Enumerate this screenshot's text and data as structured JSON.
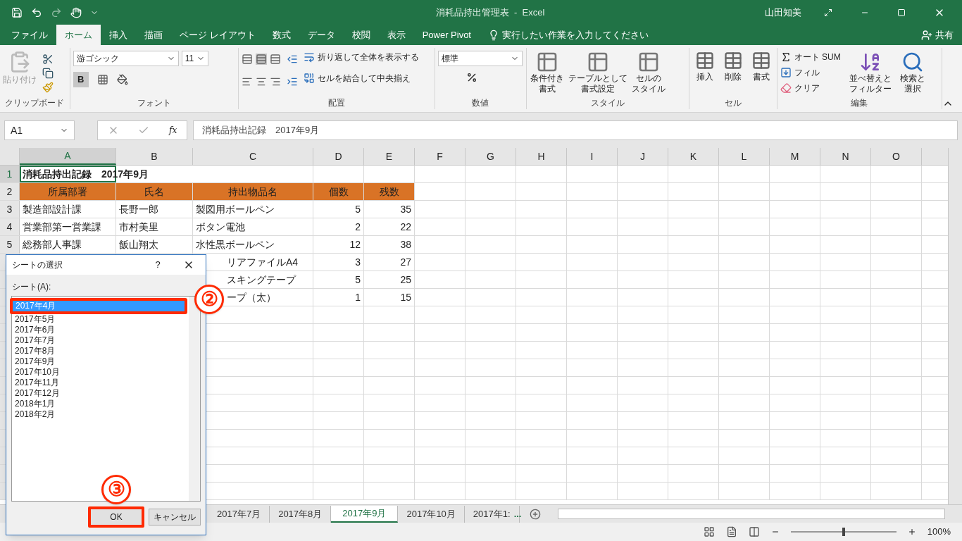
{
  "title_bar": {
    "title": "消耗品持出管理表  -  Excel",
    "user": "山田知美"
  },
  "menu_tabs": [
    {
      "label": "ファイル",
      "selected": false
    },
    {
      "label": "ホーム",
      "selected": true
    },
    {
      "label": "挿入",
      "selected": false
    },
    {
      "label": "描画",
      "selected": false
    },
    {
      "label": "ページ レイアウト",
      "selected": false
    },
    {
      "label": "数式",
      "selected": false
    },
    {
      "label": "データ",
      "selected": false
    },
    {
      "label": "校閲",
      "selected": false
    },
    {
      "label": "表示",
      "selected": false
    },
    {
      "label": "Power Pivot",
      "selected": false
    }
  ],
  "tell_me": "実行したい作業を入力してください",
  "share": "共有",
  "ribbon": {
    "clipboard": {
      "label": "クリップボード",
      "paste": "貼り付け"
    },
    "font": {
      "label": "フォント",
      "font_name": "游ゴシック",
      "font_size": "11",
      "bold_label": "B",
      "bold": true
    },
    "alignment": {
      "label": "配置",
      "wrap": "折り返して全体を表示する",
      "merge": "セルを結合して中央揃え"
    },
    "number": {
      "label": "数値",
      "format": "標準"
    },
    "styles": {
      "label": "スタイル",
      "buttons": [
        [
          "条件付き",
          "書式"
        ],
        [
          "テーブルとして",
          "書式設定"
        ],
        [
          "セルの",
          "スタイル"
        ]
      ]
    },
    "cells": {
      "label": "セル",
      "buttons": [
        "挿入",
        "削除",
        "書式"
      ]
    },
    "editing": {
      "label": "編集",
      "autosum": "オート SUM",
      "fill": "フィル",
      "clear": "クリア",
      "sort": [
        "並べ替えと",
        "フィルター"
      ],
      "find": [
        "検索と",
        "選択"
      ]
    }
  },
  "formula_bar": {
    "name_box": "A1",
    "function_label": "fx",
    "formula": "消耗品持出記録　2017年9月"
  },
  "columns": [
    {
      "label": "A",
      "selected": true
    },
    {
      "label": "B",
      "selected": false
    },
    {
      "label": "C",
      "selected": false
    },
    {
      "label": "D",
      "selected": false
    },
    {
      "label": "E",
      "selected": false
    },
    {
      "label": "F",
      "selected": false
    },
    {
      "label": "G",
      "selected": false
    },
    {
      "label": "H",
      "selected": false
    },
    {
      "label": "I",
      "selected": false
    },
    {
      "label": "J",
      "selected": false
    },
    {
      "label": "K",
      "selected": false
    },
    {
      "label": "L",
      "selected": false
    },
    {
      "label": "M",
      "selected": false
    },
    {
      "label": "N",
      "selected": false
    },
    {
      "label": "O",
      "selected": false
    }
  ],
  "rows": [
    {
      "number": "1",
      "selected": true,
      "kind": "title",
      "cells": [
        "消耗品持出記録　2017年9月"
      ]
    },
    {
      "number": "2",
      "selected": false,
      "kind": "header",
      "cells": [
        "所属部署",
        "氏名",
        "持出物品名",
        "個数",
        "残数"
      ]
    },
    {
      "number": "3",
      "selected": false,
      "kind": "data",
      "cells": [
        "製造部設計課",
        "長野一郎",
        "製図用ボールペン",
        "5",
        "35"
      ]
    },
    {
      "number": "4",
      "selected": false,
      "kind": "data",
      "cells": [
        "営業部第一営業課",
        "市村美里",
        "ボタン電池",
        "2",
        "22"
      ]
    },
    {
      "number": "5",
      "selected": false,
      "kind": "data",
      "cells": [
        "総務部人事課",
        "飯山翔太",
        "水性黒ボールペン",
        "12",
        "38"
      ]
    },
    {
      "kind": "covered",
      "cells": [
        "",
        "",
        "リアファイルA4",
        "3",
        "27"
      ]
    },
    {
      "kind": "covered",
      "cells": [
        "",
        "",
        "スキングテープ",
        "5",
        "25"
      ]
    },
    {
      "kind": "covered",
      "cells": [
        "",
        "",
        "ープ（太）",
        "1",
        "15"
      ]
    }
  ],
  "dialog": {
    "title": "シートの選択",
    "help": "?",
    "list_label": "シート(A):",
    "sheets": [
      {
        "label": "2017年4月",
        "selected": true
      },
      {
        "label": "2017年5月",
        "selected": false
      },
      {
        "label": "2017年6月",
        "selected": false
      },
      {
        "label": "2017年7月",
        "selected": false
      },
      {
        "label": "2017年8月",
        "selected": false
      },
      {
        "label": "2017年9月",
        "selected": false
      },
      {
        "label": "2017年10月",
        "selected": false
      },
      {
        "label": "2017年11月",
        "selected": false
      },
      {
        "label": "2017年12月",
        "selected": false
      },
      {
        "label": "2018年1月",
        "selected": false
      },
      {
        "label": "2018年2月",
        "selected": false
      }
    ],
    "ok": "OK",
    "cancel": "キャンセル"
  },
  "annotations": [
    "②",
    "③"
  ],
  "sheet_tabs": [
    {
      "label": "2017年7月",
      "selected": false
    },
    {
      "label": "2017年8月",
      "selected": false
    },
    {
      "label": "2017年9月",
      "selected": true
    },
    {
      "label": "2017年10月",
      "selected": false
    },
    {
      "label": "2017年1:",
      "selected": false
    }
  ],
  "more_tabs": "...",
  "status_bar": {
    "zoom": "100%",
    "zoom_slider": {
      "level": 0.5
    }
  }
}
